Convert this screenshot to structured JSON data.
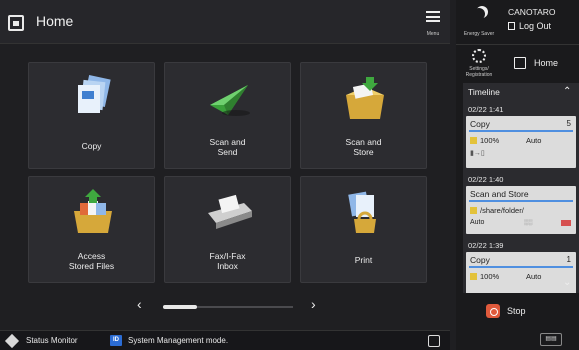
{
  "header": {
    "title": "Home",
    "menu_label": "Menu"
  },
  "functions": [
    {
      "label_lines": [
        "Copy"
      ],
      "icon": "copy-icon"
    },
    {
      "label_lines": [
        "Scan and",
        "Send"
      ],
      "icon": "scan-send-icon"
    },
    {
      "label_lines": [
        "Scan and",
        "Store"
      ],
      "icon": "scan-store-icon"
    },
    {
      "label_lines": [
        "Access",
        "Stored Files"
      ],
      "icon": "stored-files-icon"
    },
    {
      "label_lines": [
        "Fax/I-Fax",
        "Inbox"
      ],
      "icon": "fax-inbox-icon"
    },
    {
      "label_lines": [
        "Print"
      ],
      "icon": "print-icon"
    }
  ],
  "status_bar": {
    "status_monitor": "Status Monitor",
    "id_badge": "ID",
    "mode_text": "System Management mode."
  },
  "side_panel": {
    "energy_saver": "Energy Saver",
    "user": "CANOTARO",
    "logout": "Log Out",
    "settings_lines": [
      "Settings/",
      "Registration"
    ],
    "home": "Home",
    "timeline_title": "Timeline",
    "jobs": [
      {
        "time": "02/22 1:41",
        "title": "Copy",
        "count": "5",
        "detail": "100%",
        "mode": "Auto"
      },
      {
        "time": "02/22 1:40",
        "title": "Scan and Store",
        "detail": "/share/folder/",
        "mode": "Auto"
      },
      {
        "time": "02/22 1:39",
        "title": "Copy",
        "count": "1",
        "detail": "100%",
        "mode": "Auto"
      }
    ],
    "stop": "Stop"
  },
  "colors": {
    "background": "#1f1f22",
    "tile": "#2c2c30",
    "accent_blue": "#2b6cd4",
    "stop_orange": "#e05a3c"
  }
}
